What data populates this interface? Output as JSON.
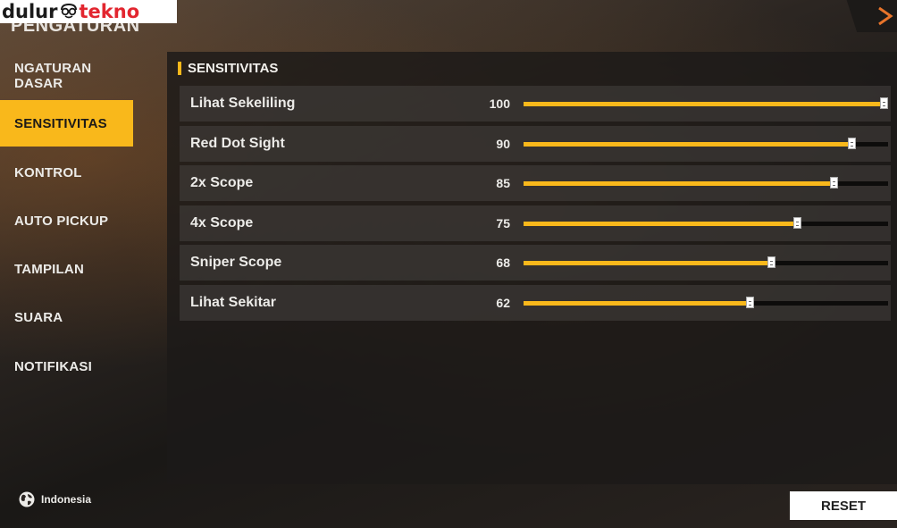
{
  "watermark": {
    "part1": "dulur",
    "part2": "tekno"
  },
  "app": {
    "title": "PENGATURAN"
  },
  "sidebar": {
    "items": [
      {
        "label": "NGATURAN DASAR",
        "active": false
      },
      {
        "label": "SENSITIVITAS",
        "active": true
      },
      {
        "label": "KONTROL",
        "active": false
      },
      {
        "label": "AUTO PICKUP",
        "active": false
      },
      {
        "label": "TAMPILAN",
        "active": false
      },
      {
        "label": "SUARA",
        "active": false
      },
      {
        "label": "NOTIFIKASI",
        "active": false
      }
    ],
    "language": {
      "icon": "globe-icon",
      "label": "Indonesia"
    }
  },
  "panel": {
    "title": "SENSITIVITAS",
    "slider_max": 100,
    "rows": [
      {
        "label": "Lihat Sekeliling",
        "value": 100
      },
      {
        "label": "Red Dot Sight",
        "value": 90
      },
      {
        "label": "2x Scope",
        "value": 85
      },
      {
        "label": "4x Scope",
        "value": 75
      },
      {
        "label": "Sniper Scope",
        "value": 68
      },
      {
        "label": "Lihat Sekitar",
        "value": 62
      }
    ]
  },
  "footer": {
    "reset_label": "RESET"
  },
  "colors": {
    "accent": "#f9b81b",
    "track": "#0d0c0b",
    "text": "#ecebe8"
  }
}
